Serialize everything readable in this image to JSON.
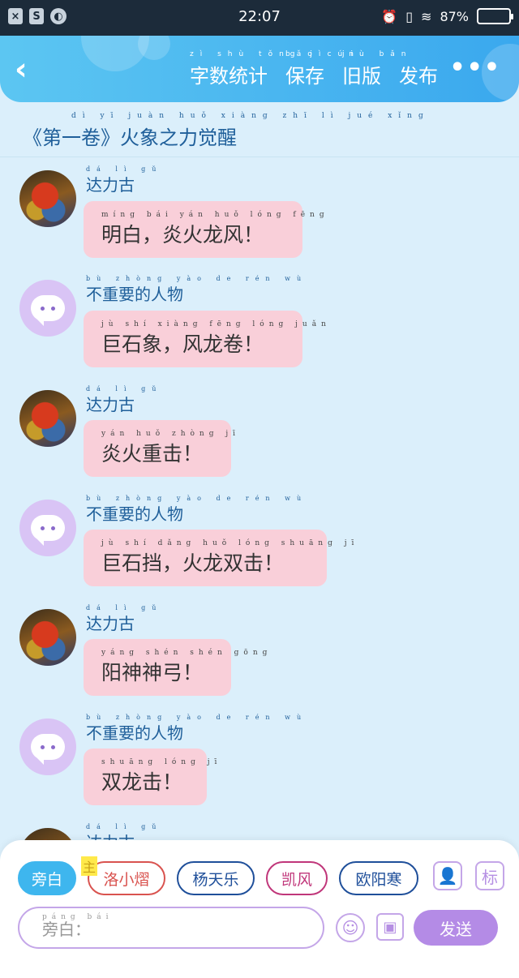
{
  "status": {
    "left_icons": [
      "close-box-icon",
      "s-app-icon",
      "browser-icon"
    ],
    "time": "22:07",
    "battery": "87%",
    "battery_level": 0.87
  },
  "header": {
    "back_icon": "‹",
    "actions": [
      {
        "label": "字数统计",
        "pinyin": "zì shù tǒng jì"
      },
      {
        "label": "保存",
        "pinyin": "bǎo cún"
      },
      {
        "label": "旧版",
        "pinyin": "jiù bǎn"
      },
      {
        "label": "发布",
        "pinyin": ""
      }
    ],
    "more": "•••"
  },
  "chapter": {
    "title": "《第一卷》火象之力觉醒",
    "pinyin": "dì yī juàn huǒ xiàng zhī lì jué xǐng"
  },
  "messages": [
    {
      "sender": "达力古",
      "sender_pinyin": "dá lì gǔ",
      "text": "明白，炎火龙风！",
      "pinyin": "míng bái yán huǒ lóng fēng",
      "avatar": "photo"
    },
    {
      "sender": "不重要的人物",
      "sender_pinyin": "bù zhòng yào de rén wù",
      "text": "巨石象，风龙卷！",
      "pinyin": "jù shí xiàng fēng lóng juǎn",
      "avatar": "cartoon"
    },
    {
      "sender": "达力古",
      "sender_pinyin": "dá lì gǔ",
      "text": "炎火重击！",
      "pinyin": "yán huǒ zhòng jī",
      "avatar": "photo"
    },
    {
      "sender": "不重要的人物",
      "sender_pinyin": "bù zhòng yào de rén wù",
      "text": "巨石挡，火龙双击！",
      "pinyin": "jù shí dǎng huǒ lóng shuāng jī",
      "avatar": "cartoon"
    },
    {
      "sender": "达力古",
      "sender_pinyin": "dá lì gǔ",
      "text": "阳神神弓！",
      "pinyin": "yáng shén shén gōng",
      "avatar": "photo"
    },
    {
      "sender": "不重要的人物",
      "sender_pinyin": "bù zhòng yào de rén wù",
      "text": "双龙击！",
      "pinyin": "shuāng lóng jī",
      "avatar": "cartoon"
    },
    {
      "sender": "达力古",
      "sender_pinyin": "dá lì gǔ",
      "text": "",
      "pinyin": "",
      "avatar": "photo"
    }
  ],
  "panel": {
    "characters": [
      {
        "label": "旁白",
        "active": true,
        "color": "#3eb6ee"
      },
      {
        "label": "洛小熠",
        "tag": "主",
        "color": "#d9534f"
      },
      {
        "label": "杨天乐",
        "color": "#1f4f9a"
      },
      {
        "label": "凯风",
        "color": "#c0367a"
      },
      {
        "label": "欧阳寒",
        "color": "#1f4f9a"
      }
    ],
    "side_buttons": [
      "person-icon",
      "标"
    ],
    "input_placeholder": "旁白：",
    "input_pinyin": "páng bái",
    "send_label": "发送",
    "accent": "#b48be6"
  }
}
